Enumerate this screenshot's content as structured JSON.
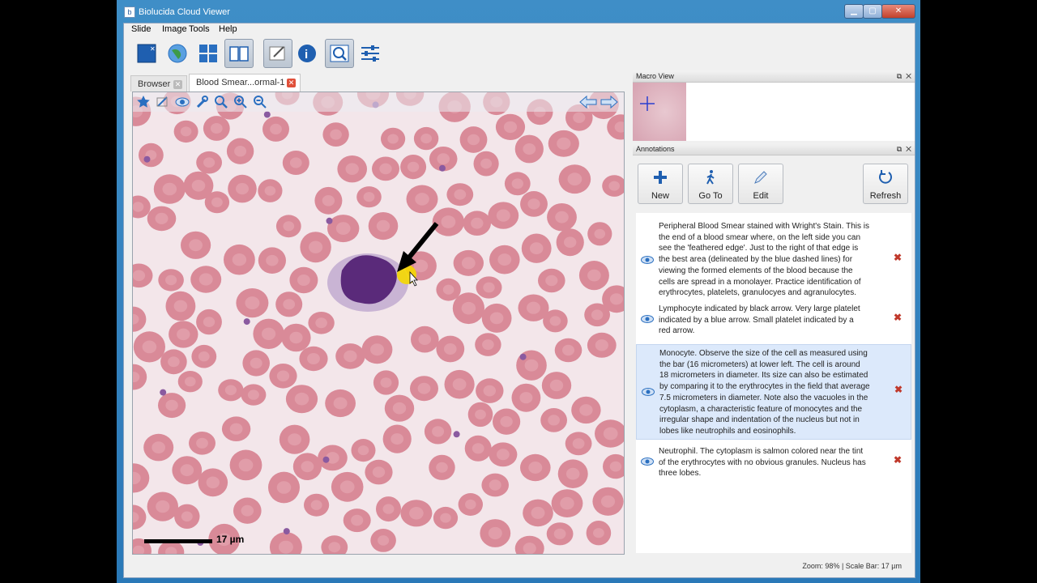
{
  "window": {
    "title": "Biolucida Cloud Viewer",
    "app_icon": "b"
  },
  "menu": [
    "Slide",
    "Image",
    "Tools",
    "Help"
  ],
  "toolbar_icons": [
    "close-slide-icon",
    "globe-icon",
    "tiles-icon",
    "book-icon",
    "annotate-icon",
    "info-icon",
    "zoom-window-icon",
    "settings-icon"
  ],
  "tabs": [
    {
      "label": "Browser",
      "active": false
    },
    {
      "label": "Blood Smear...ormal-1",
      "active": true
    }
  ],
  "viewer": {
    "scale_label": "17 µm"
  },
  "macro_view": {
    "title": "Macro View"
  },
  "annotations_panel": {
    "title": "Annotations",
    "buttons": {
      "new": "New",
      "goto": "Go To",
      "edit": "Edit",
      "refresh": "Refresh"
    },
    "items": [
      {
        "lines": [
          "Peripheral Blood Smear stained with Wright's Stain.  This is",
          "the end of a blood smear where, on the left side you can",
          "see the 'feathered edge'.  Just to the right of that edge is",
          "the best area (delineated by the blue dashed lines) for",
          "viewing the formed elements of the blood because the",
          "cells are spread in a monolayer.  Practice identification of",
          "erythrocytes, platelets, granulocyes and agranulocytes."
        ],
        "selected": false
      },
      {
        "lines": [
          "Lymphocyte indicated by black arrow.  Very large platelet",
          "indicated by a blue arrow.  Small platelet indicated by a",
          "red arrow."
        ],
        "selected": false
      },
      {
        "lines": [
          "Monocyte. Observe the size of the cell as measured using",
          "the bar (16 micrometers) at lower left.  The cell is around",
          "18 micrometers in diameter.  Its size can also be estimated",
          "by comparing it to the erythrocytes in the field that average",
          "7.5 micrometers in diameter.  Note also the vacuoles in the",
          "cytoplasm, a characteristic feature of monocytes and the",
          "irregular shape and indentation of the nucleus but not in",
          "lobes like neutrophils and eosinophils."
        ],
        "selected": true
      },
      {
        "lines": [
          "Neutrophil.  The cytoplasm is salmon colored near the tint",
          "of the erythrocytes with no obvious granules. Nucleus has",
          "three lobes."
        ],
        "selected": false
      }
    ]
  },
  "status_bar": {
    "text": "Zoom: 98% | Scale Bar: 17 µm"
  },
  "colors": {
    "rbc": "#d98a98",
    "rbc_center": "#e6aab4",
    "nucleus": "#5a2a7a",
    "background": "#f3e6ea",
    "accent": "#2a6fc0"
  }
}
